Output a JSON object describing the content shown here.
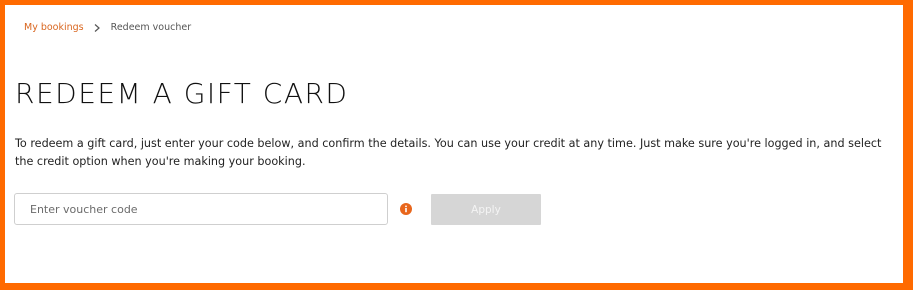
{
  "breadcrumb": {
    "parent_label": "My bookings",
    "separator_icon": "chevron-right-icon",
    "current_label": "Redeem voucher"
  },
  "page": {
    "title": "REDEEM A GIFT CARD",
    "description": "To redeem a gift card, just enter your code below, and confirm the details. You can use your credit at any time. Just make sure you're logged in, and select the credit option when you're making your booking."
  },
  "voucher_form": {
    "input_value": "",
    "input_placeholder": "Enter voucher code",
    "info_icon": "info-icon",
    "apply_label": "Apply",
    "apply_disabled": true
  },
  "colors": {
    "frame_border": "#ff6a00",
    "link": "#d9661f",
    "info_icon": "#e8661c",
    "button_disabled_bg": "#d6d6d6"
  }
}
